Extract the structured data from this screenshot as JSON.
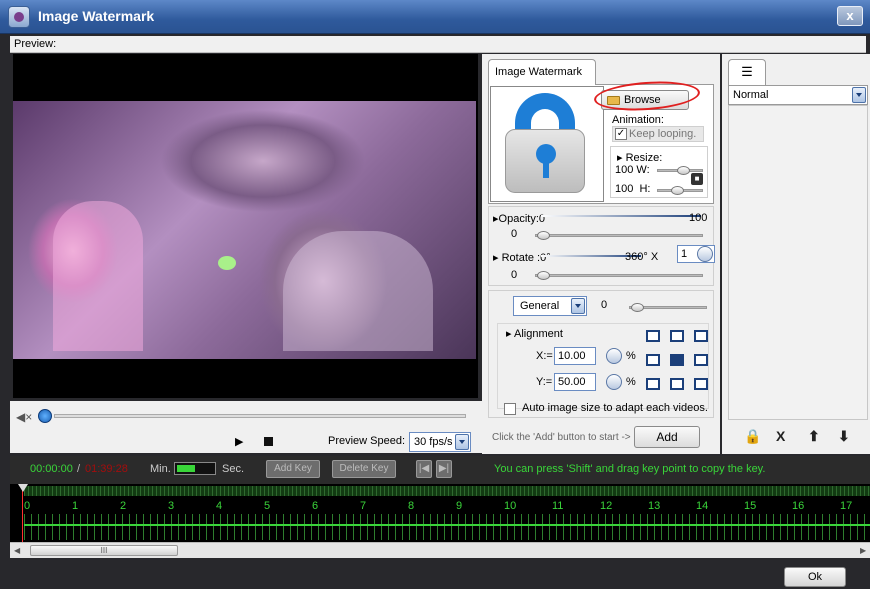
{
  "window": {
    "title": "Image Watermark",
    "close_label": "x"
  },
  "menu": {
    "preview_label": "Preview:"
  },
  "player": {
    "play_icon": "play-icon",
    "stop_icon": "stop-icon",
    "volume_icon": "volume-icon",
    "speed_label": "Preview Speed:",
    "speed_value": "30 fps/s"
  },
  "watermark_panel": {
    "tab_label": "Image Watermark",
    "browse_label": "Browse",
    "animation_label": "Animation:",
    "keep_looping_label": "Keep looping.",
    "keep_looping_checked": true,
    "resize_label": "Resize:",
    "width_value": "100",
    "width_label": "W:",
    "height_value": "100",
    "height_label": "H:",
    "opacity_label": "Opacity:",
    "opacity_min": "0",
    "opacity_max": "100",
    "opacity_value": "0",
    "rotate_label": "Rotate :",
    "rotate_min": "0°",
    "rotate_max": "360°",
    "rotate_x_label": "X",
    "rotate_x_value": "1",
    "rotate_value": "0",
    "general_select": "General",
    "general_value": "0",
    "alignment_label": "Alignment",
    "x_label": "X:=",
    "x_value": "10.00",
    "y_label": "Y:=",
    "y_value": "50.00",
    "percent": "%",
    "autosize_label": "Auto image size to adapt each videos.",
    "autosize_checked": false,
    "hint": "Click the 'Add' button to start ->",
    "add_label": "Add"
  },
  "list_panel": {
    "blend_select": "Normal",
    "tools": {
      "lock": "🔒",
      "delete": "X",
      "up": "⬆",
      "down": "⬇"
    }
  },
  "timeline": {
    "current_time": "00:00:00",
    "separator": "/",
    "total_time": "01:39:28",
    "min_label": "Min.",
    "sec_label": "Sec.",
    "add_key_label": "Add Key",
    "delete_key_label": "Delete Key",
    "prev_key_label": "|◀",
    "next_key_label": "▶|",
    "hint": "You can press 'Shift' and drag key point to copy the key.",
    "ticks": [
      "0",
      "1",
      "2",
      "3",
      "4",
      "5",
      "6",
      "7",
      "8",
      "9",
      "10",
      "11",
      "12",
      "13",
      "14",
      "15",
      "16",
      "17"
    ]
  },
  "footer": {
    "ok_label": "Ok",
    "scroll_thumb": "III"
  }
}
